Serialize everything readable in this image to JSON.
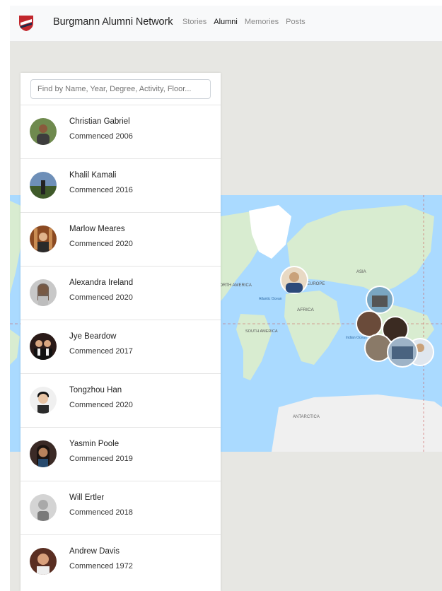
{
  "navbar": {
    "brand": "Burgmann Alumni Network",
    "links": [
      {
        "label": "Stories",
        "active": false
      },
      {
        "label": "Alumni",
        "active": true
      },
      {
        "label": "Memories",
        "active": false
      },
      {
        "label": "Posts",
        "active": false
      }
    ]
  },
  "search": {
    "placeholder": "Find by Name, Year, Degree, Activity, Floor..."
  },
  "alumni": [
    {
      "name": "Christian Gabriel",
      "commenced": "Commenced 2006"
    },
    {
      "name": "Khalil Kamali",
      "commenced": "Commenced 2016"
    },
    {
      "name": "Marlow Meares",
      "commenced": "Commenced 2020"
    },
    {
      "name": "Alexandra Ireland",
      "commenced": "Commenced 2020"
    },
    {
      "name": "Jye Beardow",
      "commenced": "Commenced 2017"
    },
    {
      "name": "Tongzhou Han",
      "commenced": "Commenced 2020"
    },
    {
      "name": "Yasmin Poole",
      "commenced": "Commenced 2019"
    },
    {
      "name": "Will Ertler",
      "commenced": "Commenced 2018"
    },
    {
      "name": "Andrew Davis",
      "commenced": "Commenced 1972"
    }
  ],
  "map": {
    "labels": {
      "north_america": "NORTH AMERICA",
      "europe": "EUROPE",
      "asia": "ASIA",
      "africa": "AFRICA",
      "south_america": "SOUTH AMERICA",
      "atlantic": "Atlantic Ocean",
      "indian": "Indian Ocean",
      "antarctica": "ANTARCTICA"
    },
    "colors": {
      "water": "#aadaff",
      "land": "#d8ecd0",
      "ice": "#ffffff",
      "background": "#e7e7e3"
    }
  }
}
